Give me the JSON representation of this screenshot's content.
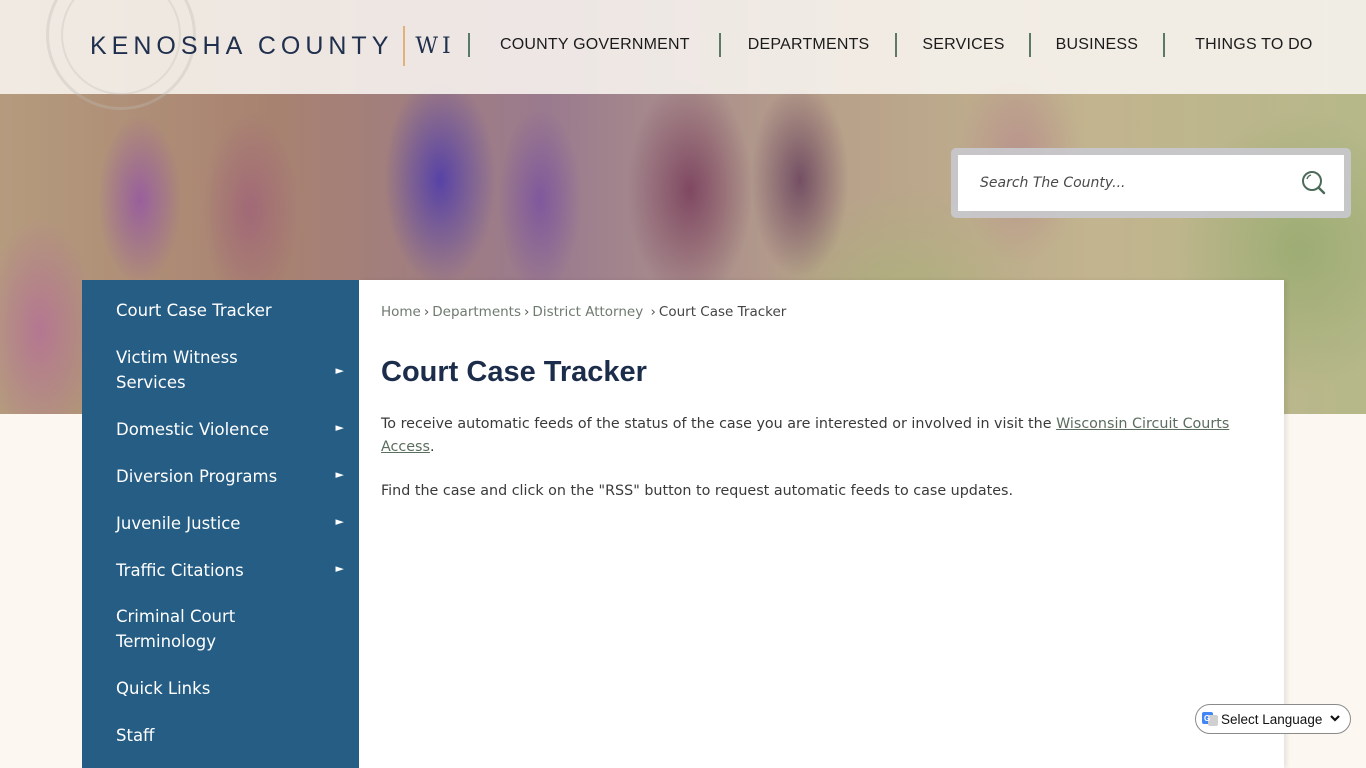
{
  "header": {
    "logo_name": "KENOSHA COUNTY",
    "logo_state": "WI",
    "nav": [
      {
        "label": "COUNTY GOVERNMENT"
      },
      {
        "label": "DEPARTMENTS"
      },
      {
        "label": "SERVICES"
      },
      {
        "label": "BUSINESS"
      },
      {
        "label": "THINGS TO DO"
      }
    ]
  },
  "search": {
    "placeholder": "Search The County...",
    "icon": "search-icon"
  },
  "sidebar": {
    "items": [
      {
        "label": "Court Case Tracker",
        "has_submenu": false
      },
      {
        "label": "Victim Witness Services",
        "has_submenu": true
      },
      {
        "label": "Domestic Violence",
        "has_submenu": true
      },
      {
        "label": "Diversion Programs",
        "has_submenu": true
      },
      {
        "label": "Juvenile Justice",
        "has_submenu": true
      },
      {
        "label": "Traffic Citations",
        "has_submenu": true
      },
      {
        "label": "Criminal Court Terminology",
        "has_submenu": false
      },
      {
        "label": "Quick Links",
        "has_submenu": false
      },
      {
        "label": "Staff",
        "has_submenu": false
      }
    ],
    "submenu_glyph": "►"
  },
  "breadcrumb": {
    "items": [
      "Home",
      "Departments",
      "District Attorney"
    ],
    "current": "Court Case Tracker",
    "separator": "›"
  },
  "main": {
    "title": "Court Case Tracker",
    "paragraph1_before": "To receive automatic feeds of the status of the case you are interested or involved in visit the ",
    "paragraph1_link": "Wisconsin Circuit Courts Access",
    "paragraph1_after": ".",
    "paragraph2": "Find the case and click on the \"RSS\" button to request automatic feeds to case updates."
  },
  "language": {
    "selected": "Select Language"
  },
  "colors": {
    "sidebar_bg": "#265d84",
    "title": "#1b2d4b",
    "nav_separator": "#5a7a68",
    "logo_accent": "#e0b27a"
  }
}
